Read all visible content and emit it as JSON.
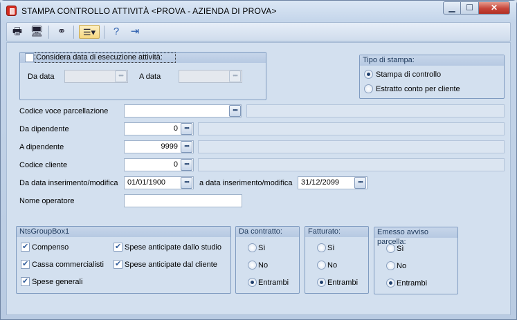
{
  "window": {
    "title": "STAMPA CONTROLLO ATTIVITÀ <PROVA - AZIENDA DI PROVA>"
  },
  "toolbar": {
    "icons": [
      "printer-icon",
      "monitor-icon",
      "binoculars-icon",
      "list-options-icon",
      "help-icon",
      "exit-icon"
    ]
  },
  "exec_date_group": {
    "checkbox_label": "Considera data di esecuzione attività:",
    "checked": false,
    "from_label": "Da data",
    "from_value": "",
    "to_label": "A data",
    "to_value": ""
  },
  "print_type": {
    "title": "Tipo di stampa:",
    "options": [
      {
        "label": "Stampa di controllo",
        "selected": true
      },
      {
        "label": "Estratto conto per cliente",
        "selected": false
      }
    ]
  },
  "fields": {
    "voce_label": "Codice voce parcellazione",
    "voce_value": "",
    "da_dip_label": "Da dipendente",
    "da_dip_value": "0",
    "a_dip_label": "A dipendente",
    "a_dip_value": "9999",
    "cliente_label": "Codice cliente",
    "cliente_value": "0",
    "da_ins_label": "Da data inserimento/modifica",
    "da_ins_value": "01/01/1900",
    "a_ins_label": "a data inserimento/modifica",
    "a_ins_value": "31/12/2099",
    "operatore_label": "Nome operatore",
    "operatore_value": ""
  },
  "group_box1": {
    "title": "NtsGroupBox1",
    "items": [
      {
        "label": "Compenso",
        "checked": true
      },
      {
        "label": "Cassa commercialisti",
        "checked": true
      },
      {
        "label": "Spese generali",
        "checked": true
      },
      {
        "label": "Spese anticipate dallo studio",
        "checked": true
      },
      {
        "label": "Spese anticipate dal cliente",
        "checked": true
      }
    ]
  },
  "contratto": {
    "title": "Da contratto:",
    "options": [
      {
        "label": "Sì",
        "selected": false
      },
      {
        "label": "No",
        "selected": false
      },
      {
        "label": "Entrambi",
        "selected": true
      }
    ]
  },
  "fatturato": {
    "title": "Fatturato:",
    "options": [
      {
        "label": "Sì",
        "selected": false
      },
      {
        "label": "No",
        "selected": false
      },
      {
        "label": "Entrambi",
        "selected": true
      }
    ]
  },
  "avviso": {
    "title": "Emesso avviso parcella:",
    "options": [
      {
        "label": "Sì",
        "selected": false
      },
      {
        "label": "No",
        "selected": false
      },
      {
        "label": "Entrambi",
        "selected": true
      }
    ]
  }
}
